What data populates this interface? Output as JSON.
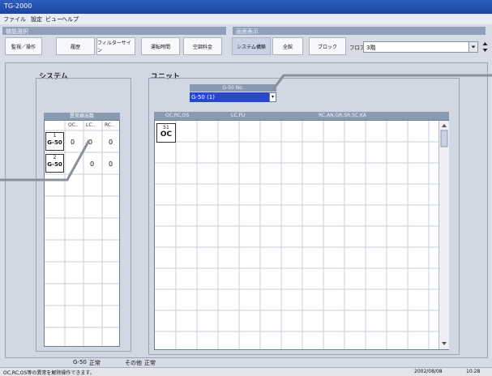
{
  "window": {
    "title": "TG-2000"
  },
  "menu": [
    "ファイル",
    "設定",
    "ビュー",
    "ヘルプ"
  ],
  "function_panel": {
    "title": "機能選択",
    "buttons": [
      "監視／操作",
      "履歴",
      "フィルターサイン",
      "運転時間",
      "空調料金"
    ]
  },
  "display_panel": {
    "title": "画面表示",
    "buttons": [
      "システム構築",
      "全館",
      "ブロック"
    ],
    "active": "システム構築",
    "floor_label": "フロアー",
    "floor_value": "3階"
  },
  "system_section": {
    "title": "システム",
    "table_title": "異常検出数",
    "columns": [
      "OC..",
      "LC..",
      "RC.."
    ],
    "rows": [
      {
        "num": "1",
        "label": "G-50",
        "values": [
          "0",
          "0",
          "0"
        ]
      },
      {
        "num": "2",
        "label": "G-50",
        "values": [
          "0",
          "0"
        ]
      }
    ]
  },
  "unit_section": {
    "title": "ユニット",
    "g50no_label": "G-50 No.",
    "g50no_value": "G-50 (1)",
    "columns": [
      "OC,RC,OS",
      "LC,FU",
      "RC,AN,GR,SR,SC,KA"
    ],
    "cells": [
      {
        "num": "51",
        "label": "OC"
      }
    ]
  },
  "status_line": {
    "g50_label": "G-50",
    "g50_status": "正常",
    "other_label": "その他",
    "other_status": "正常"
  },
  "statusbar": {
    "message": "OC,RC,OS等の異常を解除操作できます。",
    "date": "2002/08/08",
    "time": "10:28"
  },
  "colors": {
    "titlebar": "#1c43a0",
    "header": "#8fa0b8",
    "selected": "#2848c8"
  }
}
